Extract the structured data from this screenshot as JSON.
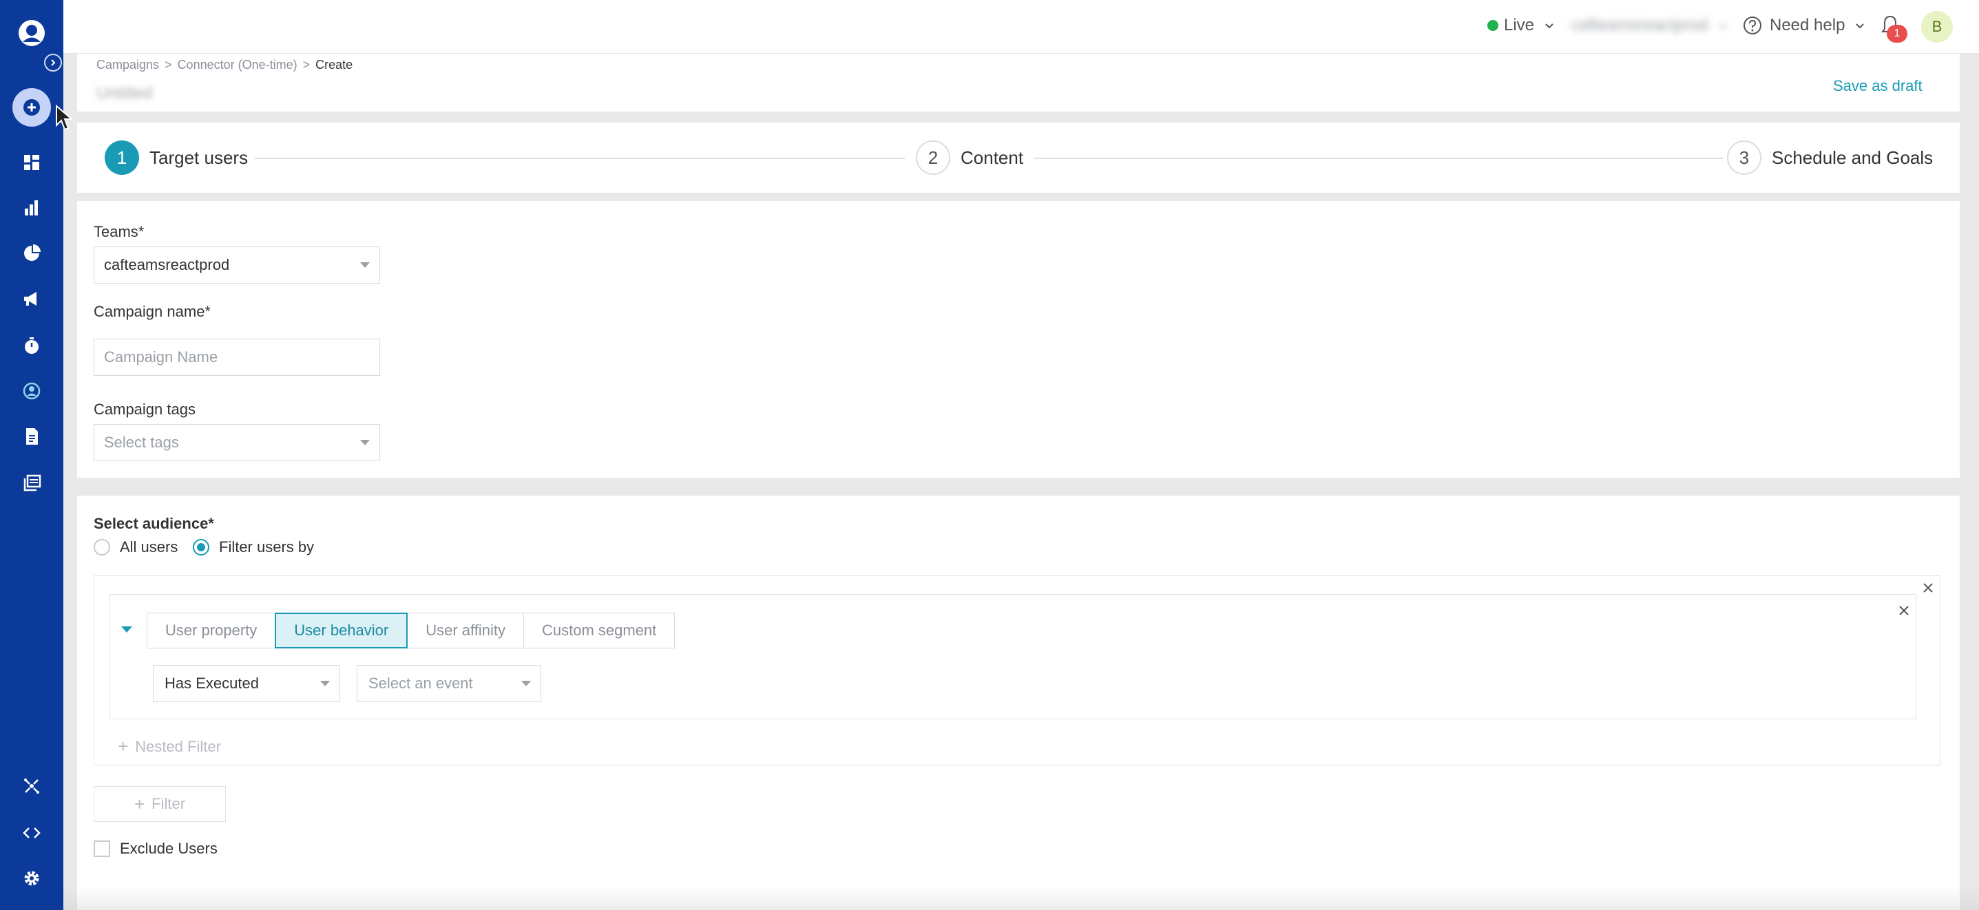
{
  "sidebar": {
    "items": [
      {
        "icon": "dashboard-icon"
      },
      {
        "icon": "bar-chart-icon"
      },
      {
        "icon": "pie-chart-icon"
      },
      {
        "icon": "megaphone-icon"
      },
      {
        "icon": "timer-icon"
      },
      {
        "icon": "user-circle-icon"
      },
      {
        "icon": "document-icon"
      },
      {
        "icon": "library-icon"
      }
    ],
    "bottom_items": [
      {
        "icon": "connector-icon"
      },
      {
        "icon": "code-icon"
      },
      {
        "icon": "gear-icon"
      }
    ]
  },
  "topbar": {
    "environment": "Live",
    "account_name": "cafteamsreactprod",
    "help_label": "Need help",
    "notification_count": "1",
    "avatar_initial": "B"
  },
  "header": {
    "breadcrumb": [
      "Campaigns",
      "Connector (One-time)",
      "Create"
    ],
    "breadcrumb_sep": ">",
    "draft_title": "Untitled",
    "save_draft_label": "Save as draft"
  },
  "stepper": {
    "steps": [
      {
        "number": "1",
        "label": "Target users"
      },
      {
        "number": "2",
        "label": "Content"
      },
      {
        "number": "3",
        "label": "Schedule and Goals"
      }
    ]
  },
  "form": {
    "teams_label": "Teams*",
    "teams_value": "cafteamsreactprod",
    "campaign_name_label": "Campaign name*",
    "campaign_name_placeholder": "Campaign Name",
    "campaign_tags_label": "Campaign tags",
    "campaign_tags_placeholder": "Select tags"
  },
  "audience": {
    "title": "Select audience*",
    "options": [
      "All users",
      "Filter users by"
    ],
    "selected": "Filter users by",
    "filter_tabs": [
      "User property",
      "User behavior",
      "User affinity",
      "Custom segment"
    ],
    "active_tab": "User behavior",
    "behavior_value": "Has Executed",
    "event_placeholder": "Select an event",
    "nested_filter_label": "Nested Filter",
    "filter_button_label": "Filter",
    "exclude_users_label": "Exclude Users"
  },
  "colors": {
    "sidebar": "#0b3a9a",
    "accent": "#1a9bb5",
    "live": "#21b04b",
    "badge": "#e94e4e"
  }
}
